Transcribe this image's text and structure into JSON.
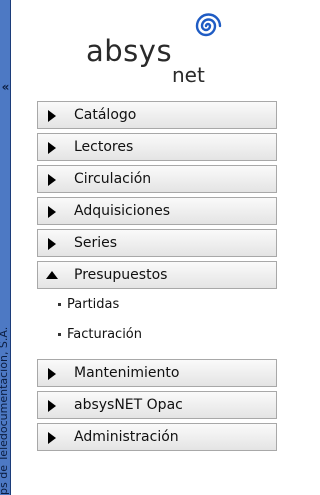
{
  "sidebar": {
    "collapse_icon": "«",
    "vertical_text": "ps de Teledocumentación, S.A.",
    "strip_color": "#4d79c4"
  },
  "logo": {
    "main": "absys",
    "sub": "net",
    "swirl_color": "#1f5cc4"
  },
  "menu": {
    "items": [
      {
        "label": "Catálogo"
      },
      {
        "label": "Lectores"
      },
      {
        "label": "Circulación"
      },
      {
        "label": "Adquisiciones"
      },
      {
        "label": "Series"
      },
      {
        "label": "Presupuestos",
        "expanded": true
      }
    ],
    "submenu": [
      {
        "label": "Partidas"
      },
      {
        "label": "Facturación"
      }
    ],
    "items_after": [
      {
        "label": "Mantenimiento"
      },
      {
        "label": "absysNET Opac"
      },
      {
        "label": "Administración"
      }
    ]
  }
}
